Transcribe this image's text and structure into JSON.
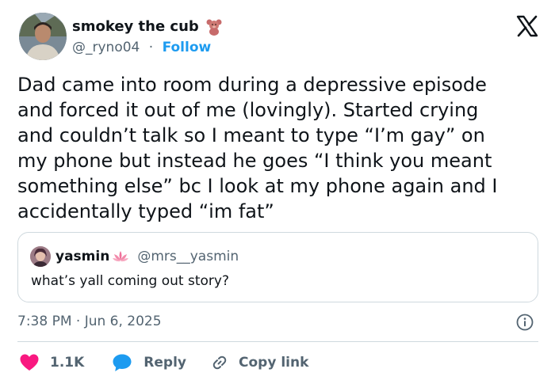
{
  "author": {
    "display_name": "smokey the cub",
    "emoji_icon": "teddy-bear-icon",
    "handle": "@_ryno04",
    "separator": "·",
    "follow_label": "Follow"
  },
  "platform_logo": "x-logo-icon",
  "tweet": {
    "text": "Dad came into room during a depressive episode\nand forced it out of me (lovingly). Started crying\nand couldn’t talk so I meant to type “I’m gay” on\nmy phone but instead he goes “I think you meant\nsomething else” bc I look at my phone again and I\naccidentally typed “im fat”"
  },
  "quote": {
    "display_name": "yasmin",
    "emoji_icon": "lotus-icon",
    "handle": "@mrs__yasmin",
    "text": "what’s yall coming out story?"
  },
  "meta": {
    "timestamp": "7:38 PM · Jun 6, 2025",
    "info_icon": "info-icon"
  },
  "actions": {
    "like_count": "1.1K",
    "reply_label": "Reply",
    "copy_label": "Copy link"
  },
  "colors": {
    "accent": "#1d9bf0",
    "like": "#f91880",
    "text": "#0f1419",
    "muted": "#536471",
    "border": "#cfd9de"
  }
}
